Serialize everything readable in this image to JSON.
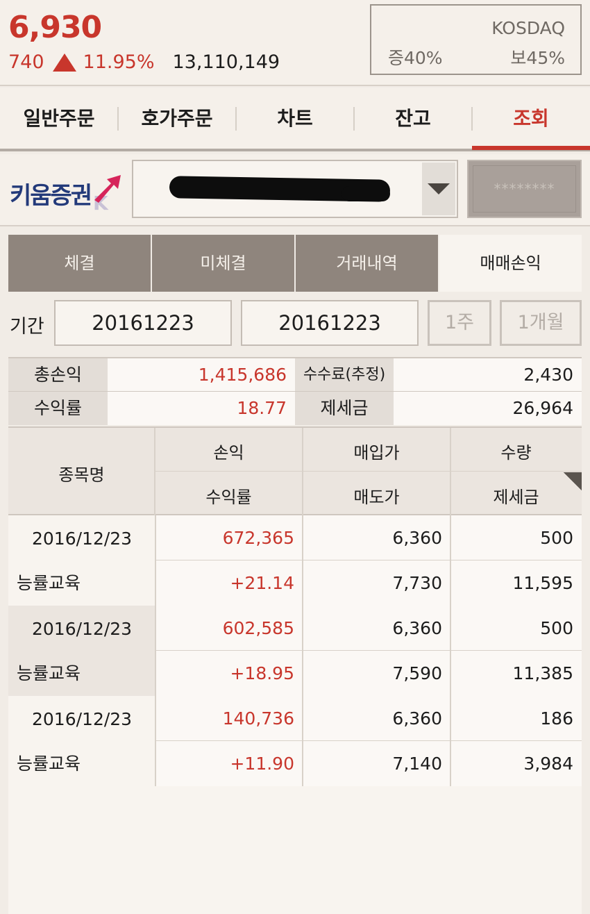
{
  "quote": {
    "price": "6,930",
    "change": "740",
    "change_pct": "11.95%",
    "volume": "13,110,149",
    "market": "KOSDAQ",
    "margin_rate": "증40%",
    "deposit_rate": "보45%",
    "colors": {
      "up": "#c8362c"
    }
  },
  "top_tabs": [
    {
      "label": "일반주문"
    },
    {
      "label": "호가주문"
    },
    {
      "label": "차트"
    },
    {
      "label": "잔고"
    },
    {
      "label": "조회",
      "active": true
    }
  ],
  "account": {
    "brand": "키움증권",
    "password_placeholder": "********"
  },
  "sub_tabs": [
    {
      "label": "체결"
    },
    {
      "label": "미체결"
    },
    {
      "label": "거래내역"
    },
    {
      "label": "매매손익",
      "active": true
    }
  ],
  "period": {
    "label": "기간",
    "start": "20161223",
    "end": "20161223",
    "btn_week": "1주",
    "btn_month": "1개월"
  },
  "summary": {
    "total_pnl_label": "총손익",
    "total_pnl": "1,415,686",
    "fee_label": "수수료(추정)",
    "fee": "2,430",
    "return_label": "수익률",
    "return_rate": "18.77",
    "tax_label": "제세금",
    "tax": "26,964"
  },
  "table": {
    "headers": {
      "name": "종목명",
      "pnl": "손익",
      "return": "수익률",
      "buy_price": "매입가",
      "sell_price": "매도가",
      "qty": "수량",
      "tax": "제세금"
    },
    "rows": [
      {
        "date": "2016/12/23",
        "name": "능률교육",
        "pnl": "672,365",
        "return": "+21.14",
        "buy_price": "6,360",
        "sell_price": "7,730",
        "qty": "500",
        "tax": "11,595"
      },
      {
        "date": "2016/12/23",
        "name": "능률교육",
        "pnl": "602,585",
        "return": "+18.95",
        "buy_price": "6,360",
        "sell_price": "7,590",
        "qty": "500",
        "tax": "11,385"
      },
      {
        "date": "2016/12/23",
        "name": "능률교육",
        "pnl": "140,736",
        "return": "+11.90",
        "buy_price": "6,360",
        "sell_price": "7,140",
        "qty": "186",
        "tax": "3,984"
      }
    ]
  }
}
